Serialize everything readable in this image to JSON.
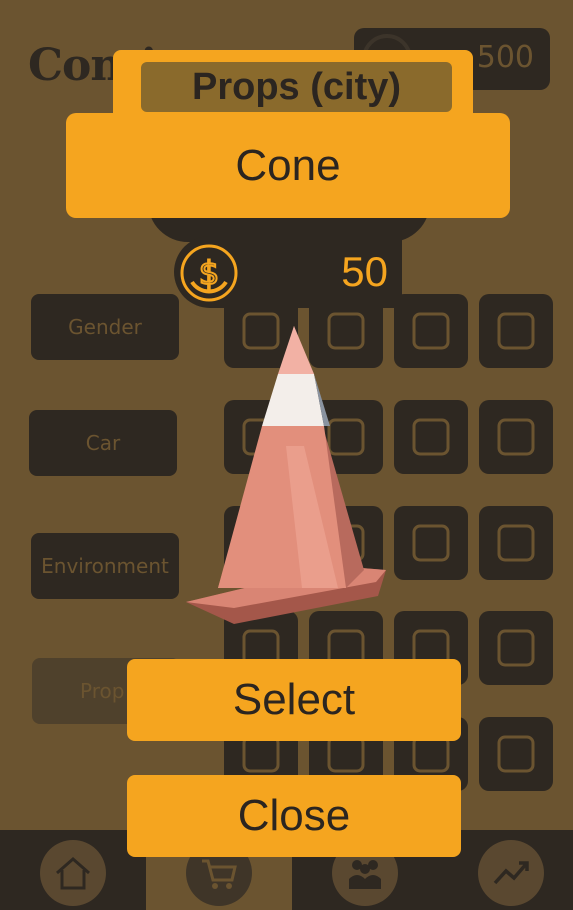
{
  "background": {
    "logo_text": "Conti",
    "coins_value": "500",
    "categories": [
      "Gender",
      "Car",
      "Environment",
      "Prop"
    ],
    "tiles": [
      {
        "icon": "pencil-icon"
      },
      {
        "icon": "garage-icon"
      },
      {
        "icon": "speed-bump-icon"
      },
      {
        "icon": "fire-hydrant-icon"
      },
      {
        "icon": "ramp-icon"
      },
      {
        "icon": "road-signs-icon"
      },
      {
        "icon": "trash-bin-icon"
      },
      {
        "icon": "rocks-icon"
      },
      {
        "icon": "fence-icon"
      },
      {
        "icon": "fence-2-icon"
      },
      {
        "icon": "fire-icon"
      },
      {
        "icon": "crashed-car-icon"
      },
      {
        "icon": "cactus-icon"
      },
      {
        "icon": "grass-icon"
      },
      {
        "icon": "bush-icon"
      },
      {
        "icon": "pine-tree-icon"
      },
      {
        "icon": "palm-tree-icon"
      },
      {
        "icon": "pineapple-icon"
      },
      {
        "icon": "snowman-icon"
      },
      {
        "icon": "tire-icon"
      }
    ],
    "nav": [
      {
        "icon": "home-icon"
      },
      {
        "icon": "cart-icon"
      },
      {
        "icon": "people-icon"
      },
      {
        "icon": "trend-icon"
      }
    ]
  },
  "modal": {
    "title": "Props (city)",
    "item_name": "Cone",
    "price": "50",
    "select_label": "Select",
    "close_label": "Close"
  },
  "colors": {
    "accent": "#f5a51f",
    "dim_background": "#6b5430",
    "dark": "#2e2821"
  }
}
